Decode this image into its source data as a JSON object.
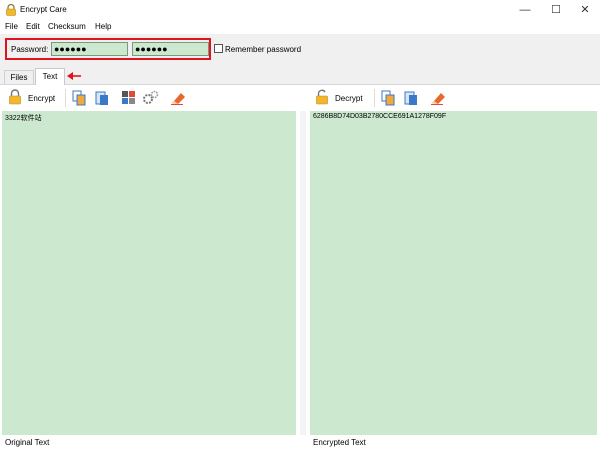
{
  "window": {
    "title": "Encrypt Care",
    "minimize": "—",
    "maximize": "☐",
    "close": "✕"
  },
  "menu": {
    "file": "File",
    "edit": "Edit",
    "checksum": "Checksum",
    "help": "Help"
  },
  "password": {
    "label": "Password:",
    "value1": "●●●●●●",
    "value2": "●●●●●●",
    "remember_label": "Remember password"
  },
  "tabs": {
    "files": "Files",
    "text": "Text"
  },
  "left_panel": {
    "action_label": "Encrypt",
    "content": "3322软件站",
    "caption": "Original Text"
  },
  "right_panel": {
    "action_label": "Decrypt",
    "content": "6286B8D74D03B2780CCE691A1278F09F",
    "caption": "Encrypted Text"
  },
  "colors": {
    "textarea_bg": "#cce8cf",
    "highlight": "#e0141e"
  }
}
